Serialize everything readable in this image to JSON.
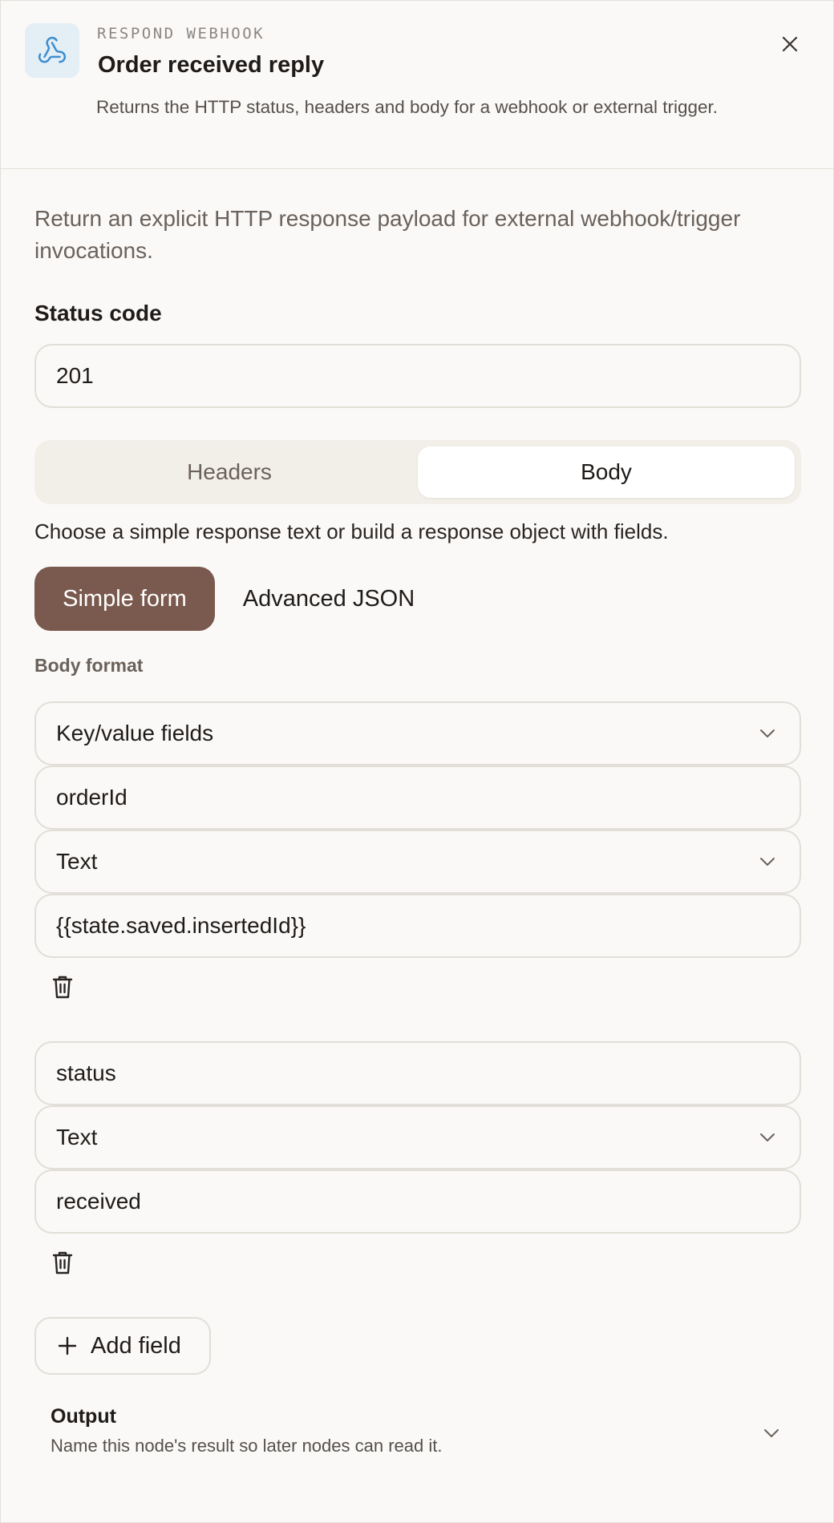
{
  "header": {
    "eyebrow": "RESPOND WEBHOOK",
    "title": "Order received reply",
    "description": "Returns the HTTP status, headers and body for a webhook or external trigger.",
    "icon": "webhook-icon",
    "close_icon": "close-icon"
  },
  "intro": "Return an explicit HTTP response payload for external webhook/trigger invocations.",
  "status_code": {
    "label": "Status code",
    "value": "201"
  },
  "tabs": [
    {
      "label": "Headers",
      "active": false
    },
    {
      "label": "Body",
      "active": true
    }
  ],
  "body_help": "Choose a simple response text or build a response object with fields.",
  "modes": [
    {
      "label": "Simple form",
      "active": true
    },
    {
      "label": "Advanced JSON",
      "active": false
    }
  ],
  "body_format": {
    "label": "Body format",
    "value": "Key/value fields"
  },
  "fields": [
    {
      "key": "orderId",
      "type": "Text",
      "value": "{{state.saved.insertedId}}"
    },
    {
      "key": "status",
      "type": "Text",
      "value": "received"
    }
  ],
  "add_field_label": "Add field",
  "output": {
    "title": "Output",
    "description": "Name this node's result so later nodes can read it."
  },
  "colors": {
    "accent": "#7a5a4e",
    "icon_bg": "#e4eef5",
    "icon_stroke": "#3d8fd1",
    "border": "#e2ded8",
    "background": "#faf9f7"
  }
}
